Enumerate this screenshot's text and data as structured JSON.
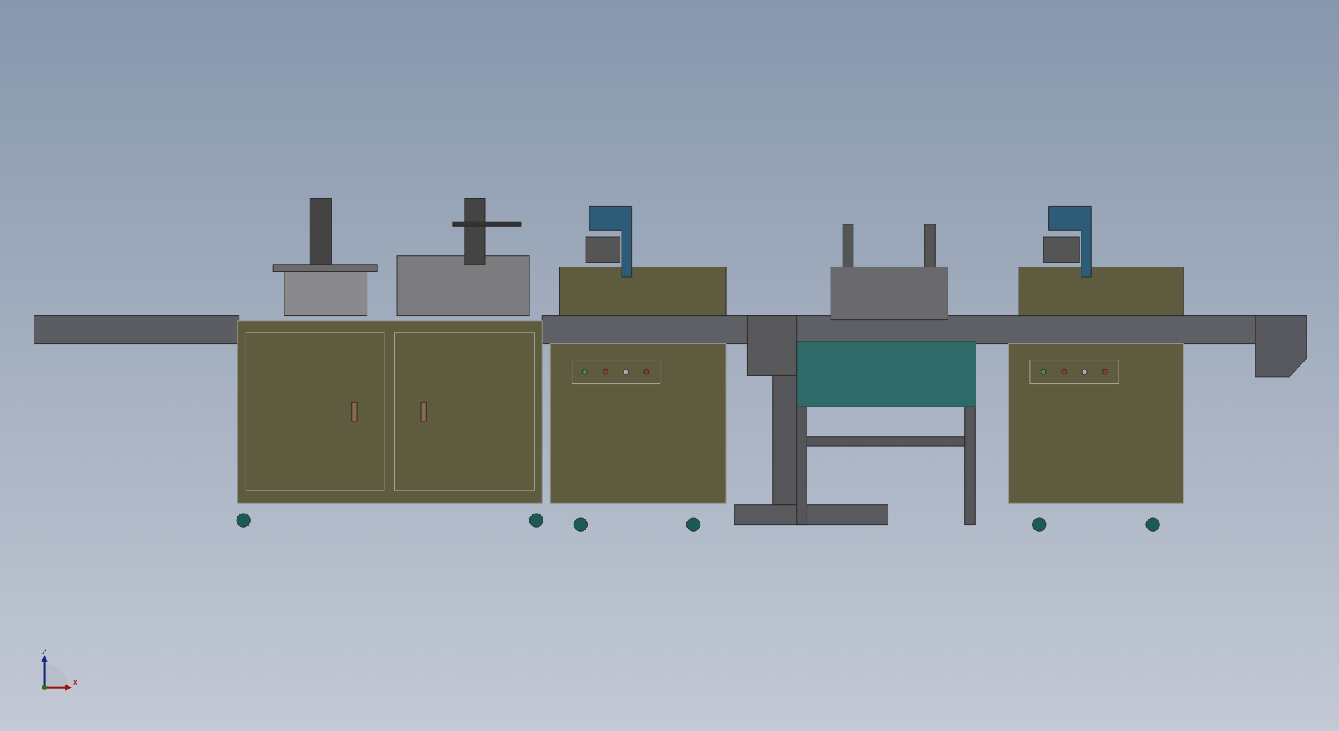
{
  "viewport": {
    "triad": {
      "z_label": "Z",
      "x_label": "X"
    }
  }
}
